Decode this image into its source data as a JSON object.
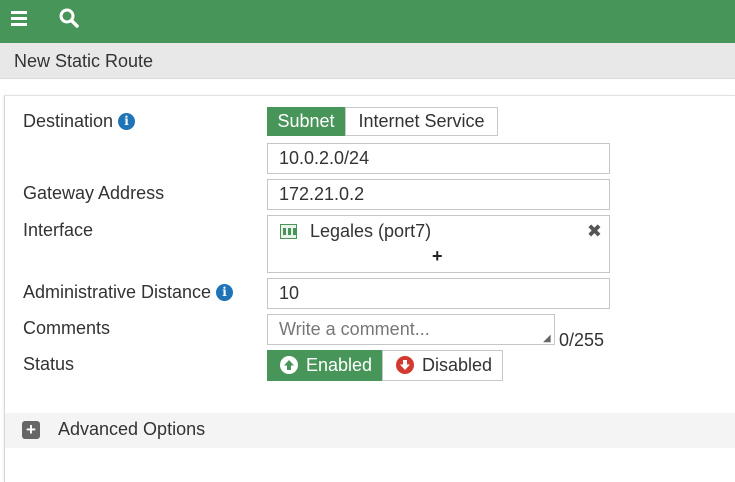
{
  "topbar": {
    "menu_icon": "hamburger-menu-icon",
    "search_icon": "search-icon",
    "color": "#48955a"
  },
  "page": {
    "title": "New Static Route"
  },
  "form": {
    "destination": {
      "label": "Destination",
      "info_icon": "info-icon",
      "options": [
        "Subnet",
        "Internet Service"
      ],
      "selected": "Subnet",
      "value": "10.0.2.0/24"
    },
    "gateway": {
      "label": "Gateway Address",
      "value": "172.21.0.2"
    },
    "interface": {
      "label": "Interface",
      "selected": "Legales (port7)",
      "port_icon": "network-port-icon",
      "remove_icon": "close-x-icon",
      "add_icon": "plus-icon",
      "add_symbol": "+",
      "remove_symbol": "✖"
    },
    "admin_distance": {
      "label": "Administrative Distance",
      "info_icon": "info-icon",
      "value": "10"
    },
    "comments": {
      "label": "Comments",
      "placeholder": "Write a comment...",
      "counter": "0/255"
    },
    "status": {
      "label": "Status",
      "options": [
        "Enabled",
        "Disabled"
      ],
      "selected": "Enabled",
      "enabled_icon": "arrow-up-circle-icon",
      "disabled_icon": "arrow-down-circle-icon"
    }
  },
  "advanced": {
    "label": "Advanced Options",
    "toggle_icon": "plus-square-icon",
    "toggle_symbol": "+"
  },
  "colors": {
    "accent": "#48955a",
    "info": "#1f73b7",
    "disabled": "#d23a2f"
  }
}
